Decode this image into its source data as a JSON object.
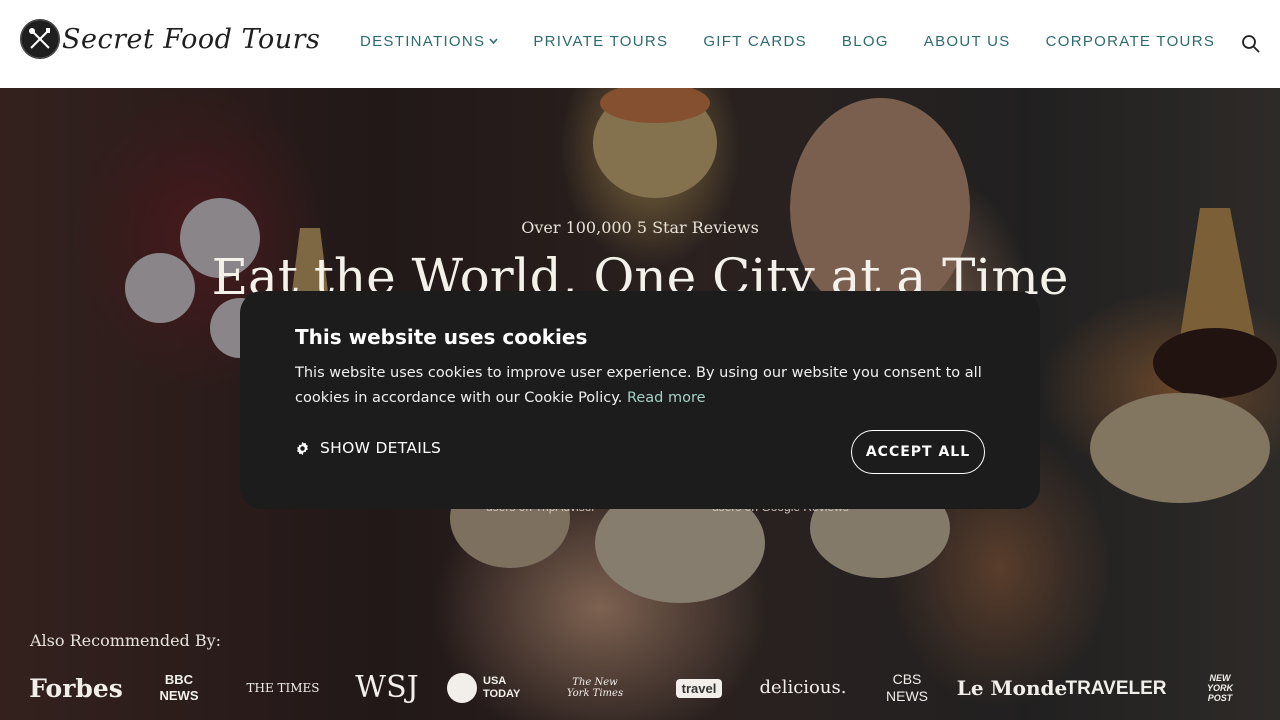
{
  "brand": {
    "name": "Secret Food Tours",
    "logo_icon": "fork-spoon-knife-icon"
  },
  "nav": {
    "items": [
      {
        "label": "DESTINATIONS",
        "has_dropdown": true
      },
      {
        "label": "PRIVATE TOURS"
      },
      {
        "label": "GIFT CARDS"
      },
      {
        "label": "BLOG"
      },
      {
        "label": "ABOUT US"
      },
      {
        "label": "CORPORATE TOURS"
      }
    ],
    "search_icon": "search-icon",
    "color": "#2e6b6d"
  },
  "hero": {
    "subtitle": "Over 100,000 5 Star Reviews",
    "title": "Eat the World, One City at a Time",
    "tripadvisor_note": "users on TripAdvisor",
    "google_note": "users on Google Reviews"
  },
  "recommended": {
    "label": "Also Recommended By:",
    "logos": [
      "Forbes",
      "BBC NEWS",
      "THE TIMES",
      "WSJ",
      "USA TODAY",
      "The New York Times",
      "travel",
      "delicious.",
      "CBS NEWS",
      "Le Monde",
      "TRAVELER",
      "NEW YORK POST"
    ]
  },
  "cookie": {
    "title": "This website uses cookies",
    "body": "This website uses cookies to improve user experience. By using our website you consent to all cookies in accordance with our Cookie Policy.",
    "read_more": "Read more",
    "show_details": "SHOW DETAILS",
    "accept_all": "ACCEPT ALL",
    "background": "#1c1c1c"
  }
}
